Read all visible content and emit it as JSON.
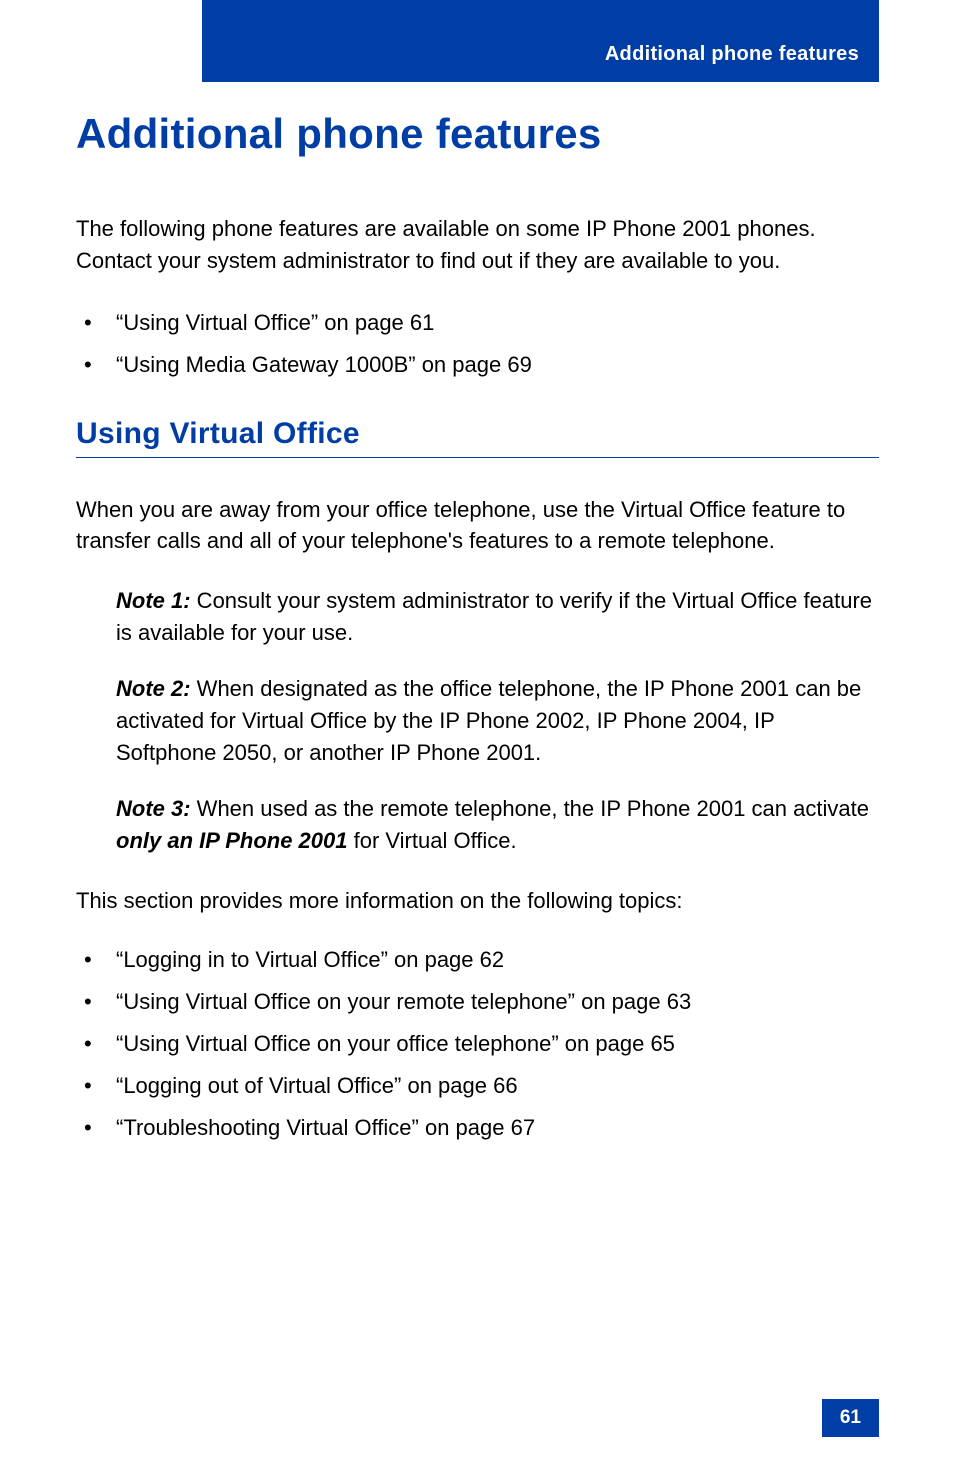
{
  "header": {
    "running_title": "Additional phone features"
  },
  "title": "Additional phone features",
  "intro": "The following phone features are available on some IP Phone 2001 phones. Contact your system administrator to find out if they are available to you.",
  "top_bullets": [
    "“Using Virtual Office” on page 61",
    "“Using Media Gateway 1000B” on page 69"
  ],
  "section": {
    "heading": "Using Virtual Office",
    "para1": "When you are away from your office telephone, use the Virtual Office feature to transfer calls and all of your telephone's features to a remote telephone.",
    "notes": [
      {
        "label": "Note 1:",
        "text": " Consult your system administrator to verify if the Virtual Office feature is available for your use."
      },
      {
        "label": "Note 2:",
        "text": " When designated as the office telephone, the IP Phone 2001 can be activated for Virtual Office by the IP Phone 2002, IP Phone 2004, IP Softphone 2050, or another IP Phone 2001."
      },
      {
        "label": "Note 3:",
        "text_before": " When used as the remote telephone, the IP Phone 2001 can activate ",
        "emph": "only an IP Phone 2001",
        "text_after": " for Virtual Office."
      }
    ],
    "para2": "This section provides more information on the following topics:",
    "sub_bullets": [
      "“Logging in to Virtual Office” on page 62",
      "“Using Virtual Office on your remote telephone” on page 63",
      "“Using Virtual Office on your office telephone” on page 65",
      "“Logging out of Virtual Office” on page 66",
      "“Troubleshooting Virtual Office” on page 67"
    ]
  },
  "page_number": "61"
}
